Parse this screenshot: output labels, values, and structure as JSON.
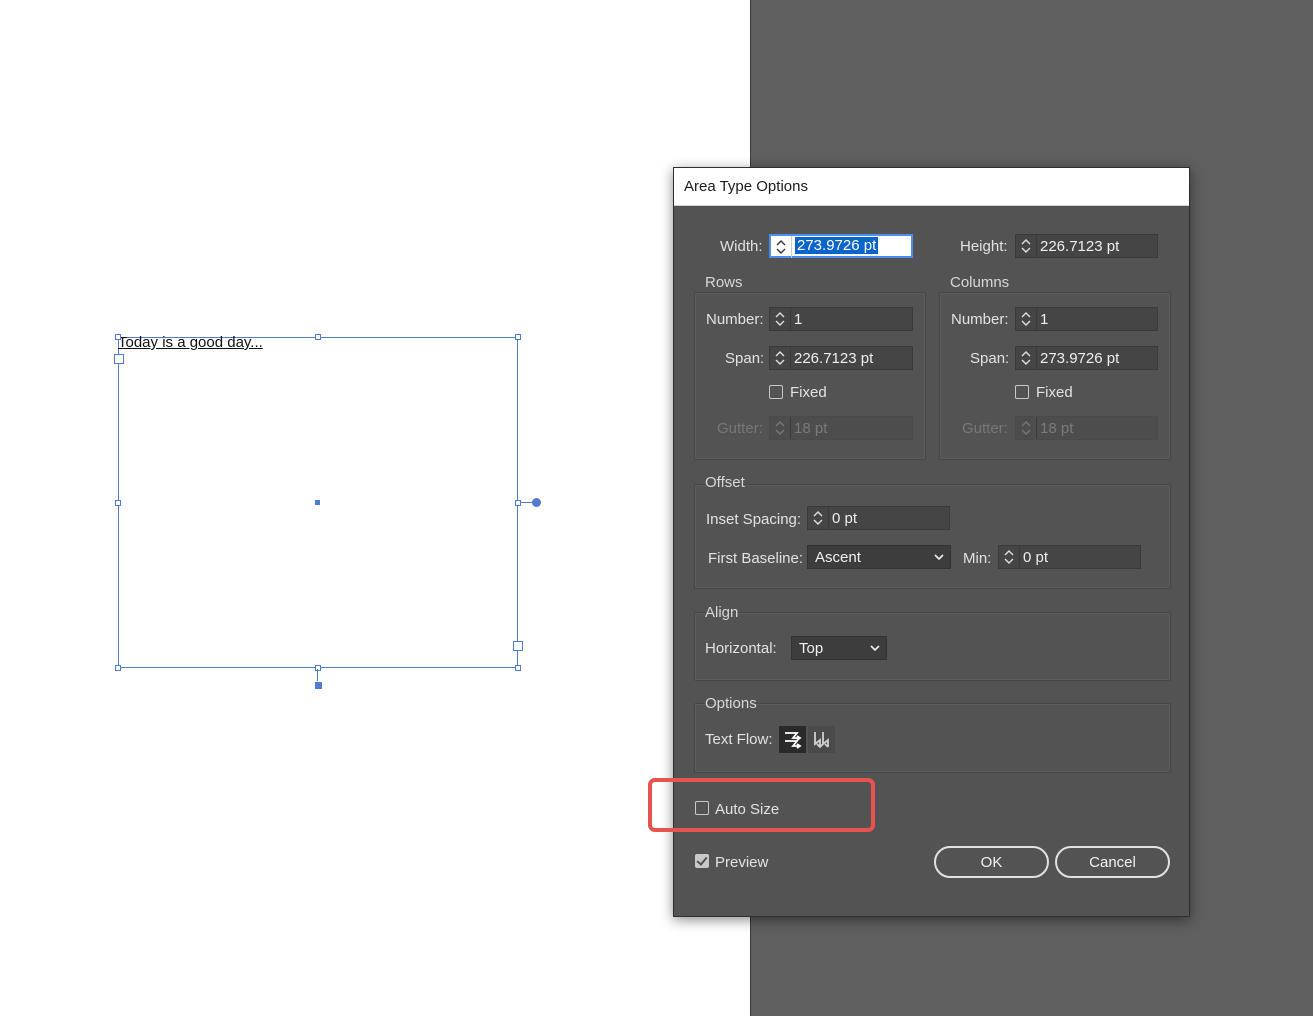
{
  "canvas": {
    "text_frame_content": "Today is a good day..."
  },
  "dialog": {
    "title": "Area Type Options",
    "width_label": "Width:",
    "width_value": "273.9726 pt",
    "height_label": "Height:",
    "height_value": "226.7123 pt",
    "rows": {
      "title": "Rows",
      "number_label": "Number:",
      "number_value": "1",
      "span_label": "Span:",
      "span_value": "226.7123 pt",
      "fixed_label": "Fixed",
      "gutter_label": "Gutter:",
      "gutter_value": "18 pt"
    },
    "columns": {
      "title": "Columns",
      "number_label": "Number:",
      "number_value": "1",
      "span_label": "Span:",
      "span_value": "273.9726 pt",
      "fixed_label": "Fixed",
      "gutter_label": "Gutter:",
      "gutter_value": "18 pt"
    },
    "offset": {
      "title": "Offset",
      "inset_label": "Inset Spacing:",
      "inset_value": "0 pt",
      "baseline_label": "First Baseline:",
      "baseline_value": "Ascent",
      "min_label": "Min:",
      "min_value": "0 pt"
    },
    "align": {
      "title": "Align",
      "horizontal_label": "Horizontal:",
      "horizontal_value": "Top"
    },
    "options": {
      "title": "Options",
      "text_flow_label": "Text Flow:"
    },
    "auto_size_label": "Auto Size",
    "preview_label": "Preview",
    "ok_label": "OK",
    "cancel_label": "Cancel"
  },
  "colors": {
    "dialog_bg": "#535353",
    "pasteboard": "#5f5f5f",
    "selection": "#4f7bd0",
    "highlight": "#e8534d"
  }
}
